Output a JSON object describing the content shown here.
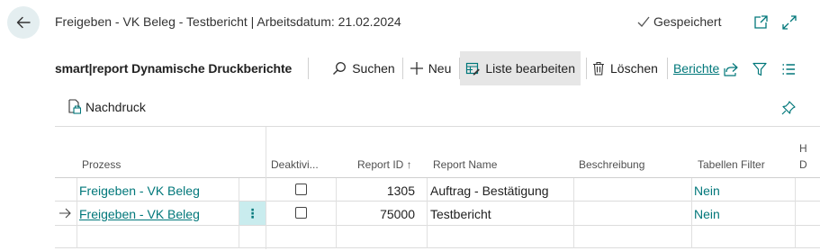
{
  "header": {
    "title": "Freigeben - VK Beleg - Testbericht | Arbeitsdatum: 21.02.2024",
    "saved_status": "Gespeichert",
    "back_icon": "arrow-left-icon",
    "open_new_icon": "open-in-new-window-icon",
    "expand_icon": "expand-icon"
  },
  "actionbar": {
    "title": "smart|report Dynamische Druckberichte",
    "search": "Suchen",
    "new": "Neu",
    "edit_list": "Liste bearbeiten",
    "delete": "Löschen",
    "reports": "Berichte"
  },
  "subactions": {
    "reprint": "Nachdruck"
  },
  "table": {
    "columns": [
      "Prozess",
      "Deaktivi...",
      "Report ID ↑",
      "Report Name",
      "Beschreibung",
      "Tabellen Filter",
      "H",
      "D"
    ],
    "rows": [
      {
        "prozess": "Freigeben - VK Beleg",
        "deaktiviert": false,
        "report_id": "1305",
        "report_name": "Auftrag - Bestätigung",
        "beschreibung": "",
        "tabellen_filter": "Nein"
      },
      {
        "prozess": "Freigeben - VK Beleg",
        "deaktiviert": false,
        "report_id": "75000",
        "report_name": "Testbericht",
        "beschreibung": "",
        "tabellen_filter": "Nein"
      }
    ]
  },
  "colors": {
    "accent": "#00777a",
    "back_button_bg": "#e4eef0",
    "active_button_bg": "#e6e6e6",
    "selected_cell_bg": "#c9ecee"
  }
}
